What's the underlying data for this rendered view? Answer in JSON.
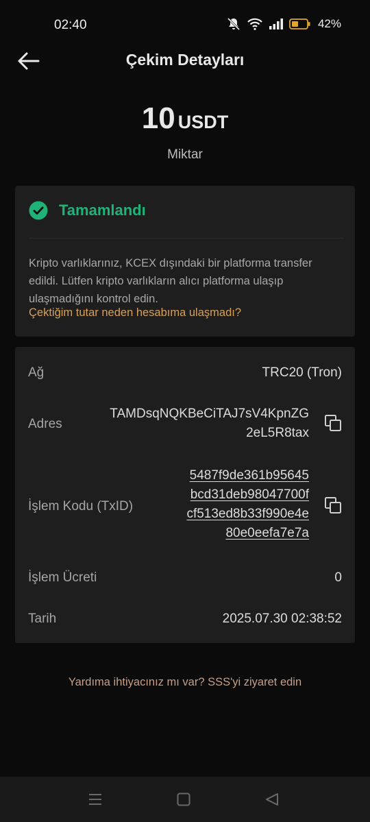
{
  "status_bar": {
    "time": "02:40",
    "battery_percent": "42%"
  },
  "header": {
    "title": "Çekim Detayları"
  },
  "amount": {
    "value": "10",
    "unit": "USDT",
    "label": "Miktar"
  },
  "status_card": {
    "status": "Tamamlandı",
    "message": "Kripto varlıklarınız, KCEX dışındaki bir platforma transfer edildi. Lütfen kripto varlıkların alıcı platforma ulaşıp ulaşmadığını kontrol edin.",
    "faq_link": "Çektiğim tutar neden hesabıma ulaşmadı?"
  },
  "details": {
    "network_label": "Ağ",
    "network_value": "TRC20 (Tron)",
    "address_label": "Adres",
    "address_lines": [
      "TAMDsqNQKBeCiTAJ7sV4KpnZG",
      "2eL5R8tax"
    ],
    "txid_label": "İşlem Kodu (TxID)",
    "txid_lines": [
      "5487f9de361b95645",
      "bcd31deb98047700f",
      "cf513ed8b33f990e4e",
      "80e0eefa7e7a"
    ],
    "fee_label": "İşlem Ücreti",
    "fee_value": "0",
    "date_label": "Tarih",
    "date_value": "2025.07.30 02:38:52"
  },
  "help": {
    "text": "Yardıma ihtiyacınız mı var? SSS'yi ziyaret edin"
  },
  "colors": {
    "background": "#0b0b0b",
    "card": "#1e1e1e",
    "success": "#1fb378",
    "link": "#d6a05c"
  }
}
